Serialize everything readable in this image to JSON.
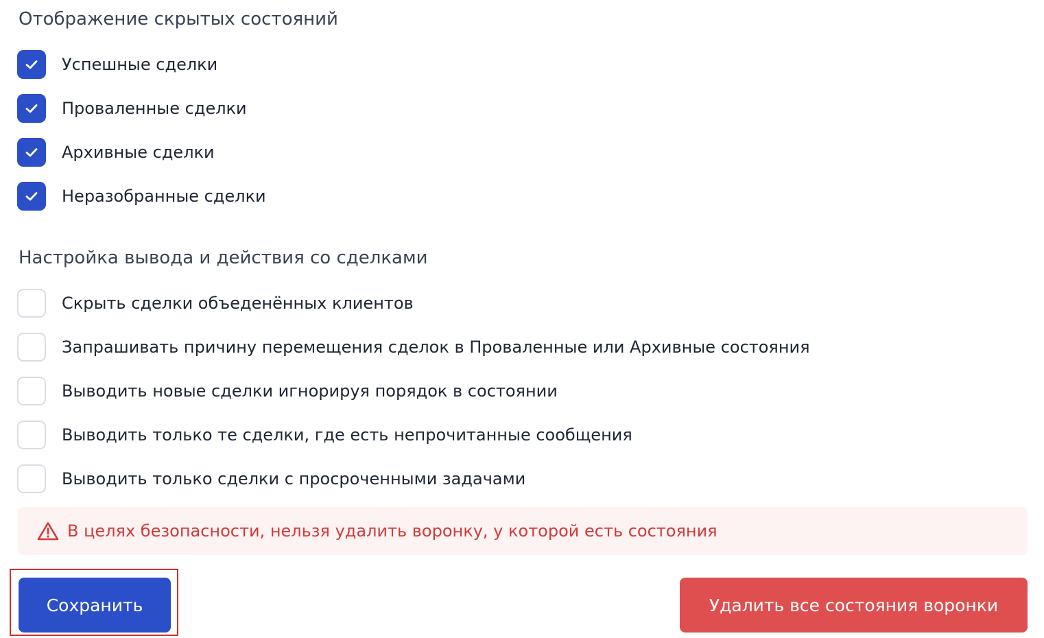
{
  "hidden_states": {
    "title": "Отображение скрытых состояний",
    "items": [
      {
        "label": "Успешные сделки",
        "checked": true
      },
      {
        "label": "Проваленные сделки",
        "checked": true
      },
      {
        "label": "Архивные сделки",
        "checked": true
      },
      {
        "label": "Неразобранные сделки",
        "checked": true
      }
    ]
  },
  "output_settings": {
    "title": "Настройка вывода и действия со сделками",
    "items": [
      {
        "label": "Скрыть сделки объеденённых клиентов",
        "checked": false
      },
      {
        "label": "Запрашивать причину перемещения сделок в Проваленные или Архивные состояния",
        "checked": false
      },
      {
        "label": "Выводить новые сделки игнорируя порядок в состоянии",
        "checked": false
      },
      {
        "label": "Выводить только те сделки, где есть непрочитанные сообщения",
        "checked": false
      },
      {
        "label": "Выводить только сделки с просроченными задачами",
        "checked": false
      }
    ]
  },
  "alert": {
    "icon": "warning-triangle-icon",
    "text": "В целях безопасности, нельзя удалить воронку, у которой есть состояния"
  },
  "actions": {
    "save_label": "Сохранить",
    "delete_label": "Удалить все состояния воронки"
  },
  "colors": {
    "primary": "#2b4fc9",
    "danger": "#df4f4f",
    "alert_bg": "#fdf3f3",
    "alert_text": "#d23a3a",
    "checkbox_border": "#d9dde4"
  }
}
